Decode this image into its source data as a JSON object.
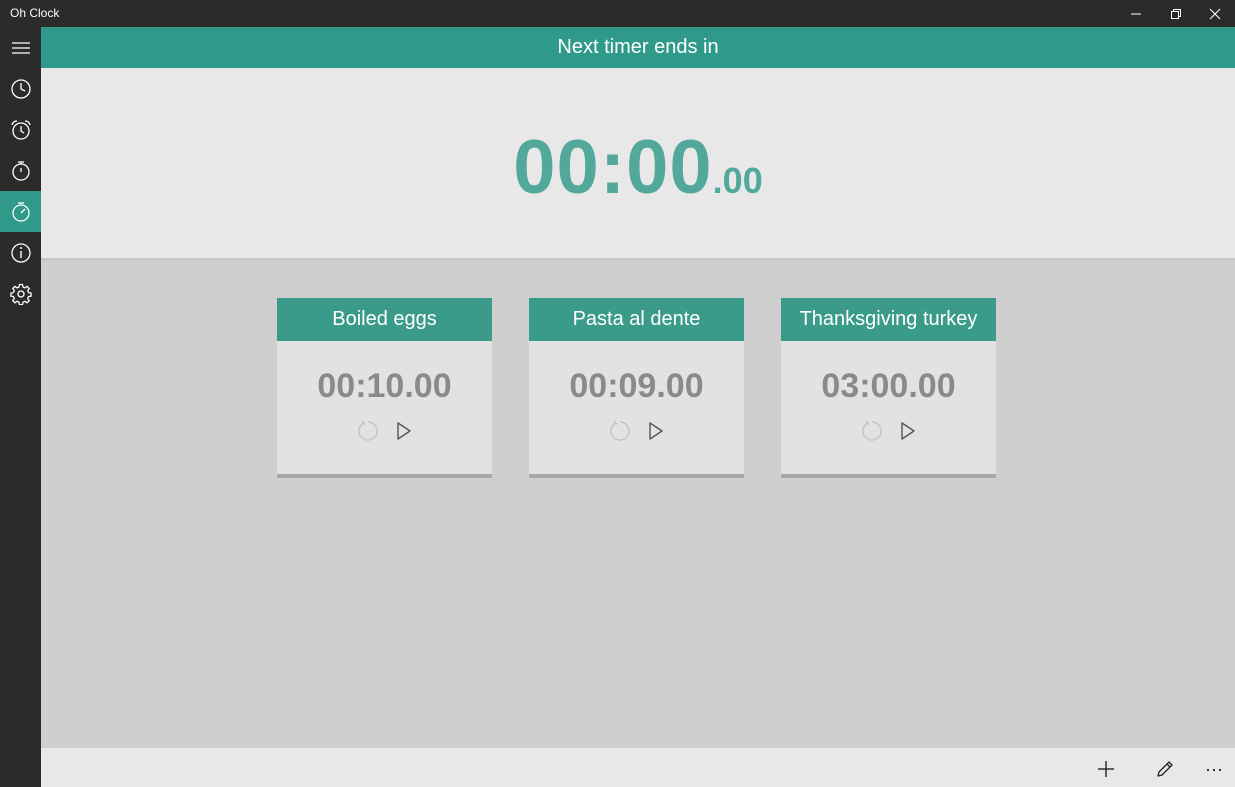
{
  "window": {
    "title": "Oh Clock"
  },
  "sidebar": {
    "items": [
      {
        "icon": "hamburger-menu-icon"
      },
      {
        "icon": "clock-icon"
      },
      {
        "icon": "alarm-icon"
      },
      {
        "icon": "stopwatch-icon"
      },
      {
        "icon": "timer-icon",
        "active": true
      },
      {
        "icon": "info-icon"
      },
      {
        "icon": "settings-gear-icon"
      }
    ]
  },
  "header": {
    "title": "Next timer ends in"
  },
  "next_timer": {
    "main": "00:00",
    "fraction": ".00"
  },
  "timers": [
    {
      "name": "Boiled eggs",
      "time": "00:10.00"
    },
    {
      "name": "Pasta al dente",
      "time": "00:09.00"
    },
    {
      "name": "Thanksgiving turkey",
      "time": "03:00.00"
    }
  ],
  "colors": {
    "accent": "#2f9a8a",
    "time_text": "#52a89a",
    "sidebar_bg": "#2b2b2b"
  }
}
